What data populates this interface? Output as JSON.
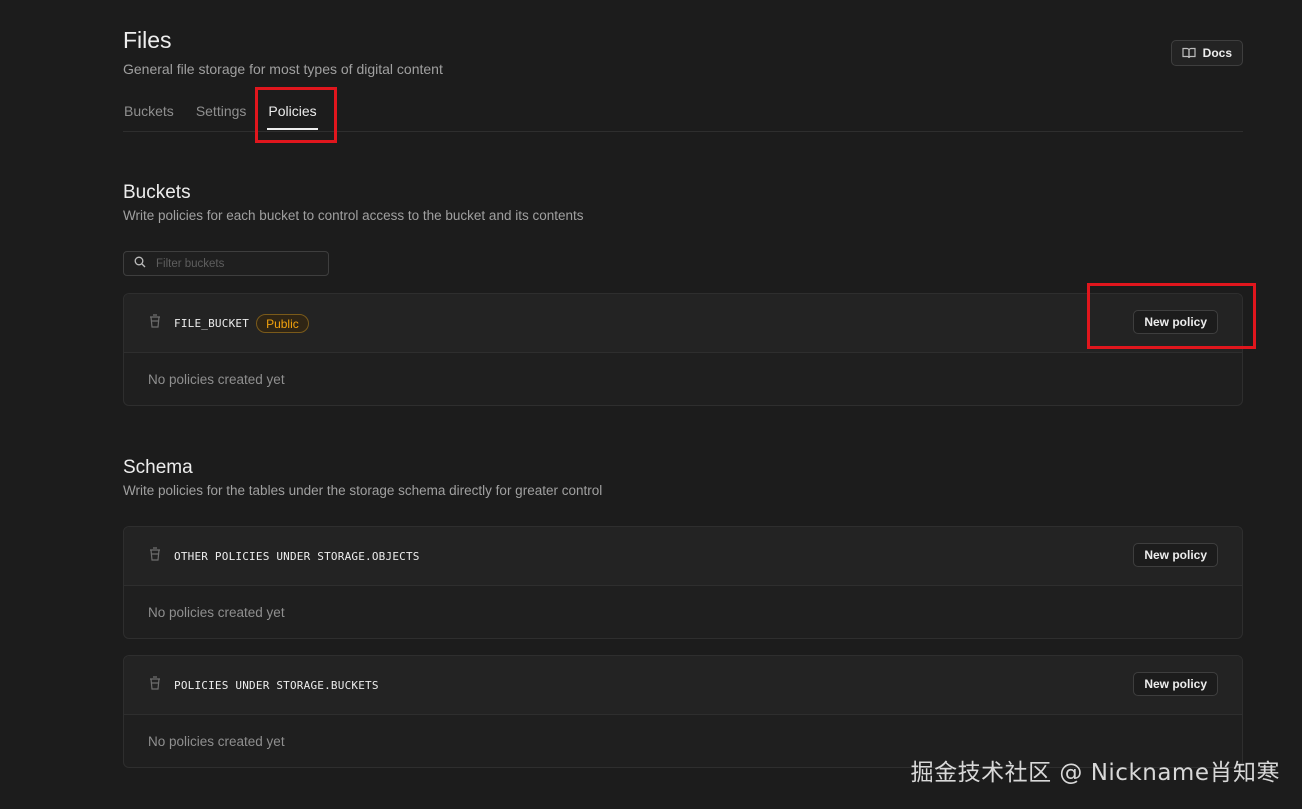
{
  "header": {
    "title": "Files",
    "subtitle": "General file storage for most types of digital content",
    "docs_label": "Docs"
  },
  "tabs": [
    {
      "label": "Buckets",
      "active": false
    },
    {
      "label": "Settings",
      "active": false
    },
    {
      "label": "Policies",
      "active": true
    }
  ],
  "buckets_section": {
    "title": "Buckets",
    "description": "Write policies for each bucket to control access to the bucket and its contents",
    "filter_placeholder": "Filter buckets",
    "cards": [
      {
        "name": "FILE_BUCKET",
        "badge": "Public",
        "button": "New policy",
        "empty_text": "No policies created yet"
      }
    ]
  },
  "schema_section": {
    "title": "Schema",
    "description": "Write policies for the tables under the storage schema directly for greater control",
    "cards": [
      {
        "name": "OTHER POLICIES UNDER STORAGE.OBJECTS",
        "button": "New policy",
        "empty_text": "No policies created yet"
      },
      {
        "name": "POLICIES UNDER STORAGE.BUCKETS",
        "button": "New policy",
        "empty_text": "No policies created yet"
      }
    ]
  },
  "watermark": "掘金技术社区 @ Nickname肖知寒",
  "colors": {
    "background": "#1c1c1c",
    "badge": "#f1a10d",
    "annotation": "#e0161d"
  }
}
